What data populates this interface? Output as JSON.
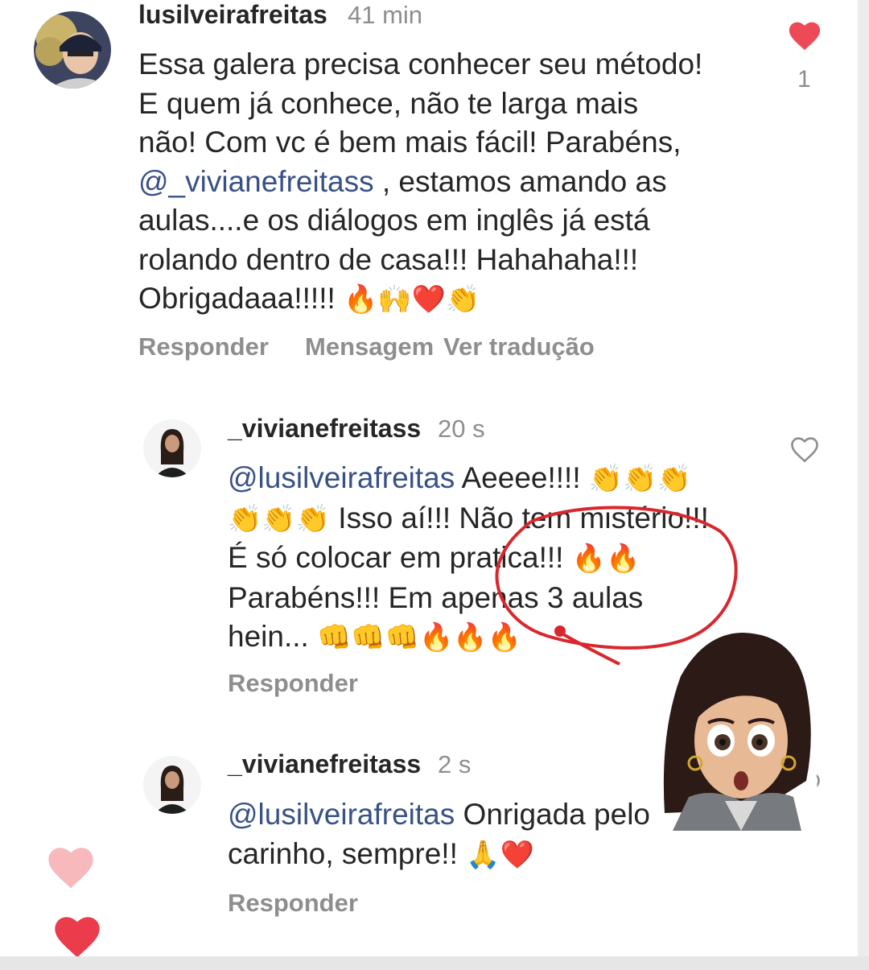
{
  "colors": {
    "like_active": "#ed4956",
    "mention": "#385185",
    "muted": "#8e8e8e",
    "annotation": "#d9272e"
  },
  "comments": [
    {
      "username": "lusilveirafreitas",
      "time": "41 min",
      "text_parts": [
        "Essa galera precisa conhecer seu método!\nE quem já conhece, não te larga mais\nnão! Com vc é bem mais fácil! Parabéns,\n",
        "@_vivianefreitass",
        " , estamos amando as\naulas....e os diálogos em inglês já está\nrolando dentro de casa!!! Hahahaha!!!\nObrigadaaa!!!!! ",
        "🔥🙌❤️👏"
      ],
      "like_icon": "heart-filled-icon",
      "like_count": "1",
      "actions": {
        "reply": "Responder",
        "message": "Mensagem",
        "translate": "Ver tradução"
      }
    },
    {
      "username": "_vivianefreitass",
      "time": "20 s",
      "text_parts": [
        "@lusilveirafreitas",
        " Aeeee!!!! ",
        "👏👏👏\n👏👏👏",
        " Isso aí!!! Não tem mistério!!!\nÉ  só colocar em pratica!!! ",
        "🔥🔥",
        "\nParabéns!!! Em apenas 3 aulas\nhein... ",
        "👊👊👊🔥🔥🔥"
      ],
      "like_icon": "heart-outline-icon",
      "actions": {
        "reply": "Responder"
      }
    },
    {
      "username": "_vivianefreitass",
      "time": "2 s",
      "text_parts": [
        "@lusilveirafreitas",
        " Onrigada pelo\ncarinho, sempre!! ",
        "🙏❤️"
      ],
      "like_icon": "heart-outline-icon",
      "actions": {
        "reply": "Responder"
      }
    }
  ],
  "floating_hearts": [
    "heart-light-pink-icon",
    "heart-red-icon"
  ],
  "sticker": "surprised-woman-sticker",
  "annotation": "red-circle-highlight"
}
